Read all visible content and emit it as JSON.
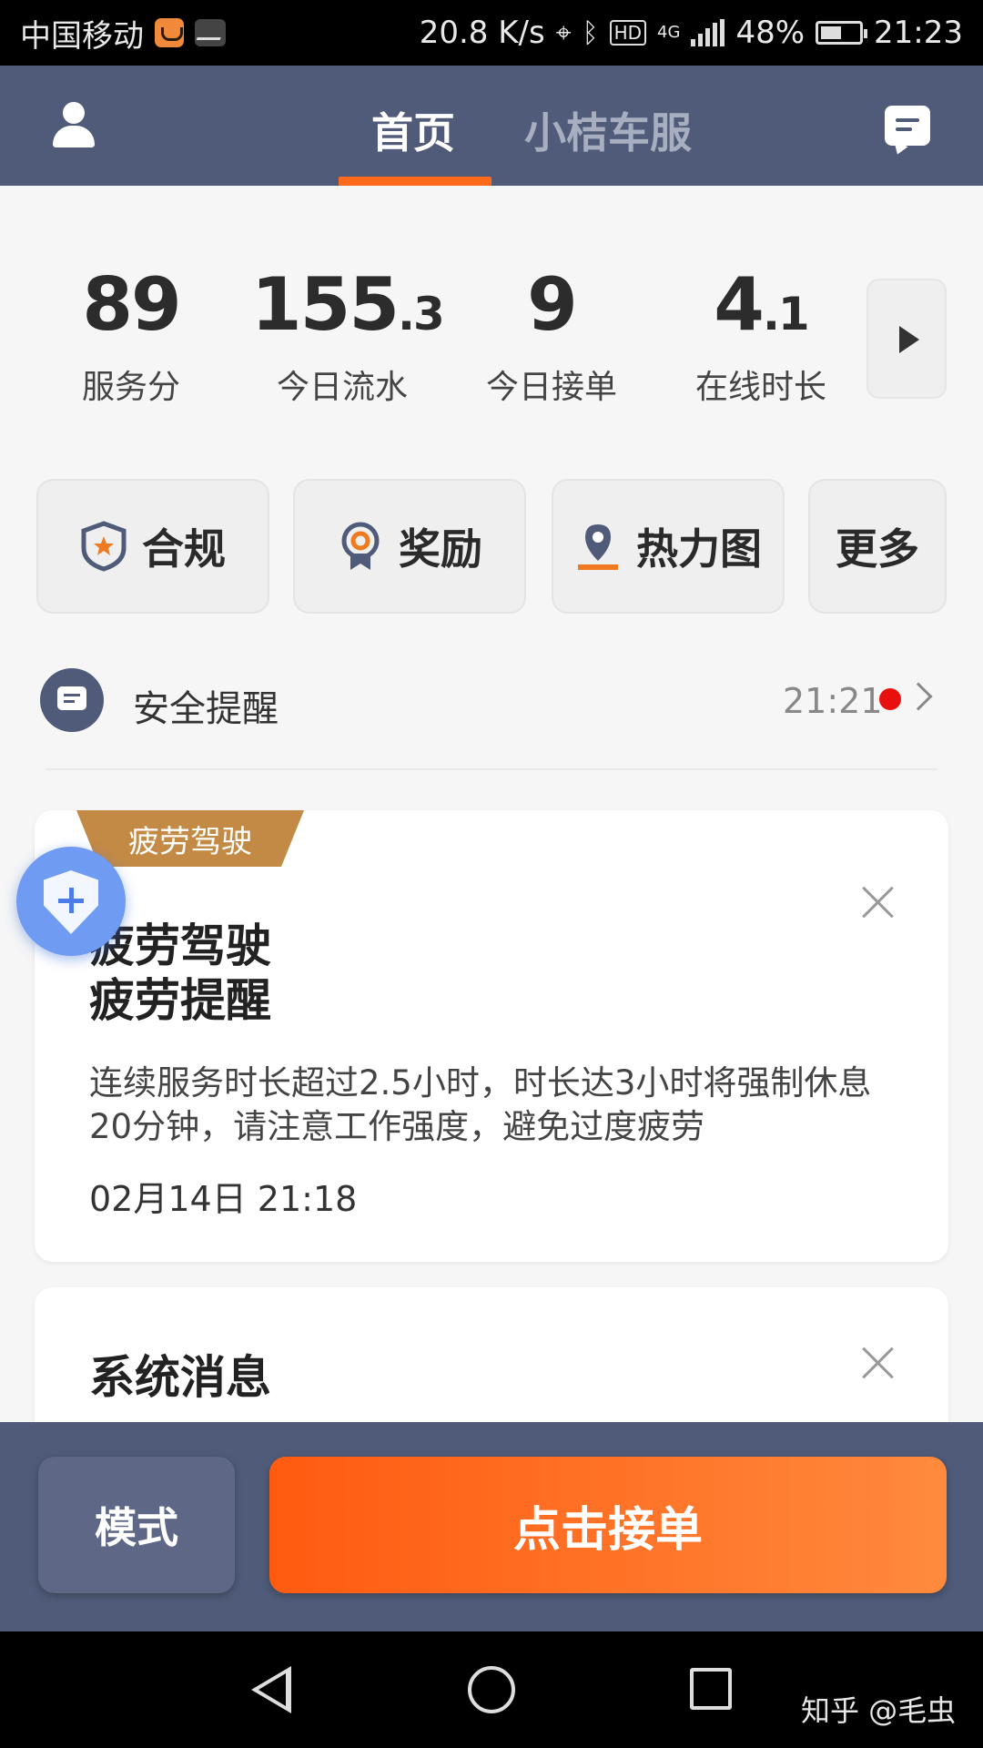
{
  "status_bar": {
    "carrier": "中国移动",
    "net_speed": "20.8 K/s",
    "hd": "HD",
    "network_type": "4G",
    "battery": "48%",
    "time": "21:23"
  },
  "header": {
    "tabs": [
      {
        "label": "首页",
        "active": true
      },
      {
        "label": "小桔车服",
        "active": false
      }
    ],
    "accent_color": "#ff6a1a",
    "background_color": "#4f5b78"
  },
  "stats": [
    {
      "value": "89",
      "decimal": "",
      "label": "服务分"
    },
    {
      "value": "155",
      "decimal": ".3",
      "label": "今日流水"
    },
    {
      "value": "9",
      "decimal": "",
      "label": "今日接单"
    },
    {
      "value": "4",
      "decimal": ".1",
      "label": "在线时长"
    }
  ],
  "quick_actions": [
    {
      "label": "合规",
      "icon": "shield-star-icon"
    },
    {
      "label": "奖励",
      "icon": "medal-icon"
    },
    {
      "label": "热力图",
      "icon": "map-pin-icon"
    },
    {
      "label": "更多",
      "icon": ""
    }
  ],
  "safety_reminder": {
    "title": "安全提醒",
    "time": "21:21",
    "unread": true
  },
  "cards": [
    {
      "tag": "疲劳驾驶",
      "title_line1": "疲劳驾驶",
      "title_line2": "疲劳提醒",
      "body": "连续服务时长超过2.5小时，时长达3小时将强制休息20分钟，请注意工作强度，避免过度疲劳",
      "date": "02月14日 21:18"
    },
    {
      "title_line1": "系统消息"
    }
  ],
  "bottom_actions": {
    "mode_label": "模式",
    "accept_label": "点击接单"
  },
  "watermark": "知乎 @毛虫"
}
